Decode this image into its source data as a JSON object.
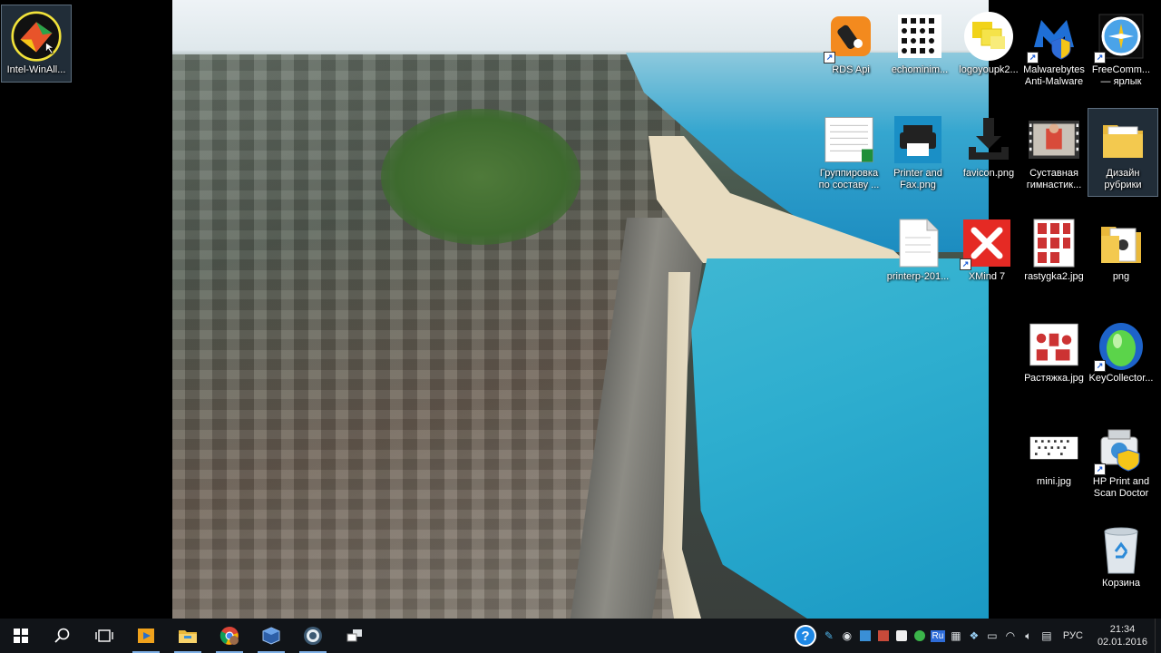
{
  "desktop": {
    "icons": [
      {
        "label": "Intel-WinAll..."
      },
      {
        "label": "RDS Api"
      },
      {
        "label": "echominim..."
      },
      {
        "label": "logoyoupk2..."
      },
      {
        "label": "Malwarebytes Anti-Malware"
      },
      {
        "label": "FreeComm... — ярлык"
      },
      {
        "label": "Группировка по составу ..."
      },
      {
        "label": "Printer and Fax.png"
      },
      {
        "label": "favicon.png"
      },
      {
        "label": "Суставная гимнастик..."
      },
      {
        "label": "Дизайн рубрики"
      },
      {
        "label": "printerp-201..."
      },
      {
        "label": "XMind 7"
      },
      {
        "label": "rastygka2.jpg"
      },
      {
        "label": "png"
      },
      {
        "label": "Растяжка.jpg"
      },
      {
        "label": "KeyCollector..."
      },
      {
        "label": "mini.jpg"
      },
      {
        "label": "HP Print and Scan Doctor"
      },
      {
        "label": "Корзина"
      }
    ]
  },
  "taskbar": {
    "start_icon": "windows-start-icon",
    "search_icon": "search-icon",
    "task_view_icon": "task-view-icon",
    "apps": [
      {
        "name": "media-player-icon"
      },
      {
        "name": "file-explorer-icon"
      },
      {
        "name": "chrome-icon"
      },
      {
        "name": "virtualbox-icon"
      },
      {
        "name": "app-circle-icon"
      },
      {
        "name": "remote-desktop-icon"
      }
    ]
  },
  "tray": {
    "help_icon": "?",
    "language": "РУС",
    "time": "21:34",
    "date": "02.01.2016",
    "ru_badge": "Ru"
  },
  "colors": {
    "taskbar": "#111418",
    "accent": "#7fb0e6",
    "lake": "#2eaecf"
  }
}
